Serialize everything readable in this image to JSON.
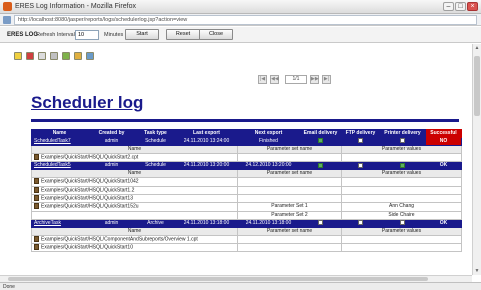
{
  "window": {
    "title": "ERES Log Information - Mozilla Firefox"
  },
  "address_bar": {
    "url": "http://localhost:8080/jasper/reports/logs/schedulerlog.jsp?action=view"
  },
  "toolbar": {
    "eres_label": "ERES LOG",
    "interval_label": "Refresh Interval :",
    "interval_value": "10",
    "unit_label": "Minutes",
    "start_label": "Start",
    "reset_label": "Reset",
    "close_label": "Close"
  },
  "icons": [
    "filter-icon",
    "refresh-icon",
    "settings-icon",
    "delete-icon",
    "export-icon",
    "save-icon",
    "print-icon"
  ],
  "pager": {
    "first": "|◀",
    "prev": "◀◀",
    "current": "1/1",
    "next": "▶▶",
    "last": "▶|"
  },
  "page": {
    "heading": "Scheduler log"
  },
  "table": {
    "columns": [
      "Name",
      "Created by",
      "Task type",
      "Last export",
      "Next export",
      "Email delivery",
      "FTP delivery",
      "Printer delivery",
      "Successful"
    ],
    "tasks": [
      {
        "name": "ScheduledTask7",
        "created_by": "admin",
        "task_type": "Schedule",
        "last_export": "24.11.2010 13:24:00",
        "next_export": "Finished",
        "email": true,
        "ftp": false,
        "printer": false,
        "status": "NO",
        "files": [
          {
            "file": "Examples/QuickStart/HSQL/QuickStart2.cpt",
            "param_name": "",
            "param_value": ""
          }
        ]
      },
      {
        "name": "ScheduledTask5",
        "created_by": "admin",
        "task_type": "Schedule",
        "last_export": "24.11.2010 13:20:00",
        "next_export": "24.12.2010 13:20:00",
        "email": true,
        "ftp": false,
        "printer": true,
        "status": "OK",
        "files": [
          {
            "file": "Examples/QuickStart/HSQL/QuickStart1042",
            "param_name": "",
            "param_value": ""
          },
          {
            "file": "Examples/QuickStart/HSQL/QuickStart1.2",
            "param_name": "",
            "param_value": ""
          },
          {
            "file": "Examples/QuickStart/HSQL/QuickStart13",
            "param_name": "",
            "param_value": ""
          },
          {
            "file": "Examples/QuickStart/HSQL/QuickStart152u",
            "param_name": "Parameter Set 1",
            "param_value": "Ann Chang"
          },
          {
            "file": "",
            "param_name": "Parameter Set 2",
            "param_value": "Side Chaire"
          }
        ]
      },
      {
        "name": "ArchiveTask",
        "created_by": "admin",
        "task_type": "Archive",
        "last_export": "24.11.2010 13:18:00",
        "next_export": "24.11.2010 13:18:00",
        "email": false,
        "ftp": false,
        "printer": false,
        "status": "OK",
        "files": [
          {
            "file": "Examples/QuickStart/HSQL/ComponentAndSubreports/Overview 1.cpt",
            "param_name": "",
            "param_value": ""
          },
          {
            "file": "Examples/QuickStart/HSQL/QuickStart10",
            "param_name": "",
            "param_value": ""
          }
        ]
      }
    ],
    "sub_headers": {
      "name": "Name",
      "param_set": "Parameter set name",
      "param_values": "Parameter values"
    }
  },
  "status_bar": {
    "text": "Done"
  },
  "colors": {
    "accent": "#1a1a8c",
    "error": "#cc0000"
  }
}
